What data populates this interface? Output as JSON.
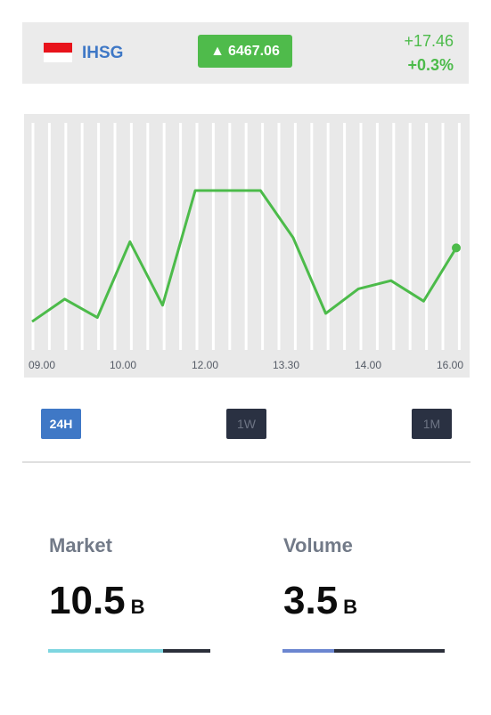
{
  "header": {
    "ticker": "IHSG",
    "price_arrow": "▲",
    "price": "6467.06",
    "change_abs": "+17.46",
    "change_pct": "+0.3%",
    "flag_icon": "indonesia-flag-icon"
  },
  "colors": {
    "accent_green": "#4fbb4b",
    "accent_blue": "#3f78c6",
    "line": "#4cbb4a",
    "market_bar": "#7ed6e0",
    "volume_bar": "#6b86d0"
  },
  "chart_data": {
    "type": "line",
    "x_tick_labels": [
      "09.00",
      "10.00",
      "12.00",
      "13.30",
      "14.00",
      "16.00"
    ],
    "series": [
      {
        "values": [
          0.16,
          0.27,
          0.18,
          0.55,
          0.24,
          0.8,
          0.8,
          0.8,
          0.57,
          0.2,
          0.32,
          0.36,
          0.26,
          0.52
        ]
      }
    ],
    "ylim": [
      0,
      1
    ],
    "grid": "vertical",
    "end_marker": true
  },
  "range_buttons": [
    {
      "label": "24H",
      "active": true
    },
    {
      "label": "1W",
      "active": false
    },
    {
      "label": "1M",
      "active": false
    }
  ],
  "stats": {
    "market": {
      "label": "Market",
      "value": "10.5",
      "unit": "B",
      "fill_fraction": 0.71
    },
    "volume": {
      "label": "Volume",
      "value": "3.5",
      "unit": "B",
      "fill_fraction": 0.32
    }
  }
}
